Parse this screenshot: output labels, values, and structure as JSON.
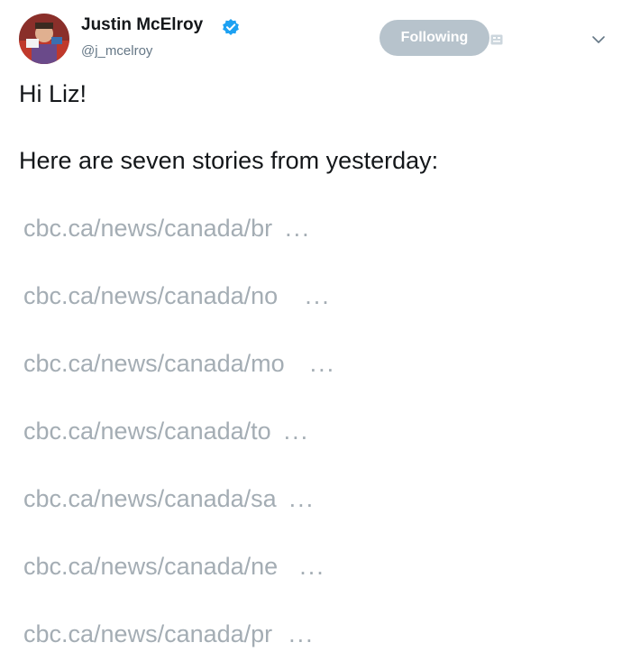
{
  "tweet": {
    "author": {
      "name": "Justin McElroy",
      "handle": "@j_mcelroy",
      "verified": true
    },
    "follow_button": {
      "label": "Following"
    },
    "icons": {
      "verified": "verified-badge-icon",
      "follows_you": "follows-you-icon",
      "more": "chevron-down-icon"
    },
    "colors": {
      "link": "#a4adb4",
      "follow_button": "#b7c3cc",
      "verified": "#1da1f2",
      "text": "#14171a",
      "secondary": "#657786"
    },
    "body": {
      "greeting": "Hi Liz!",
      "intro": "Here are seven stories from yesterday:",
      "links": [
        "cbc.ca/news/canada/br",
        "cbc.ca/news/canada/no",
        "cbc.ca/news/canada/mo",
        "cbc.ca/news/canada/to",
        "cbc.ca/news/canada/sa",
        "cbc.ca/news/canada/ne",
        "cbc.ca/news/canada/pr"
      ],
      "ellipsis": "..."
    }
  }
}
